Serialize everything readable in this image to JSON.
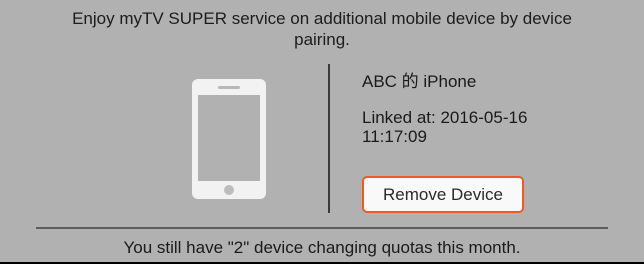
{
  "intro_text": "Enjoy myTV SUPER service on additional mobile device by device pairing.",
  "device": {
    "icon": "smartphone-icon",
    "name": "ABC 的 iPhone",
    "linked_label": "Linked at: 2016-05-16 11:17:09"
  },
  "remove_button_label": "Remove Device",
  "quota_text": "You still have \"2\" device changing quotas this month.",
  "colors": {
    "panel_background": "#b1b1b1",
    "accent_border": "#ee5a24",
    "button_background": "#f9f9f9"
  }
}
